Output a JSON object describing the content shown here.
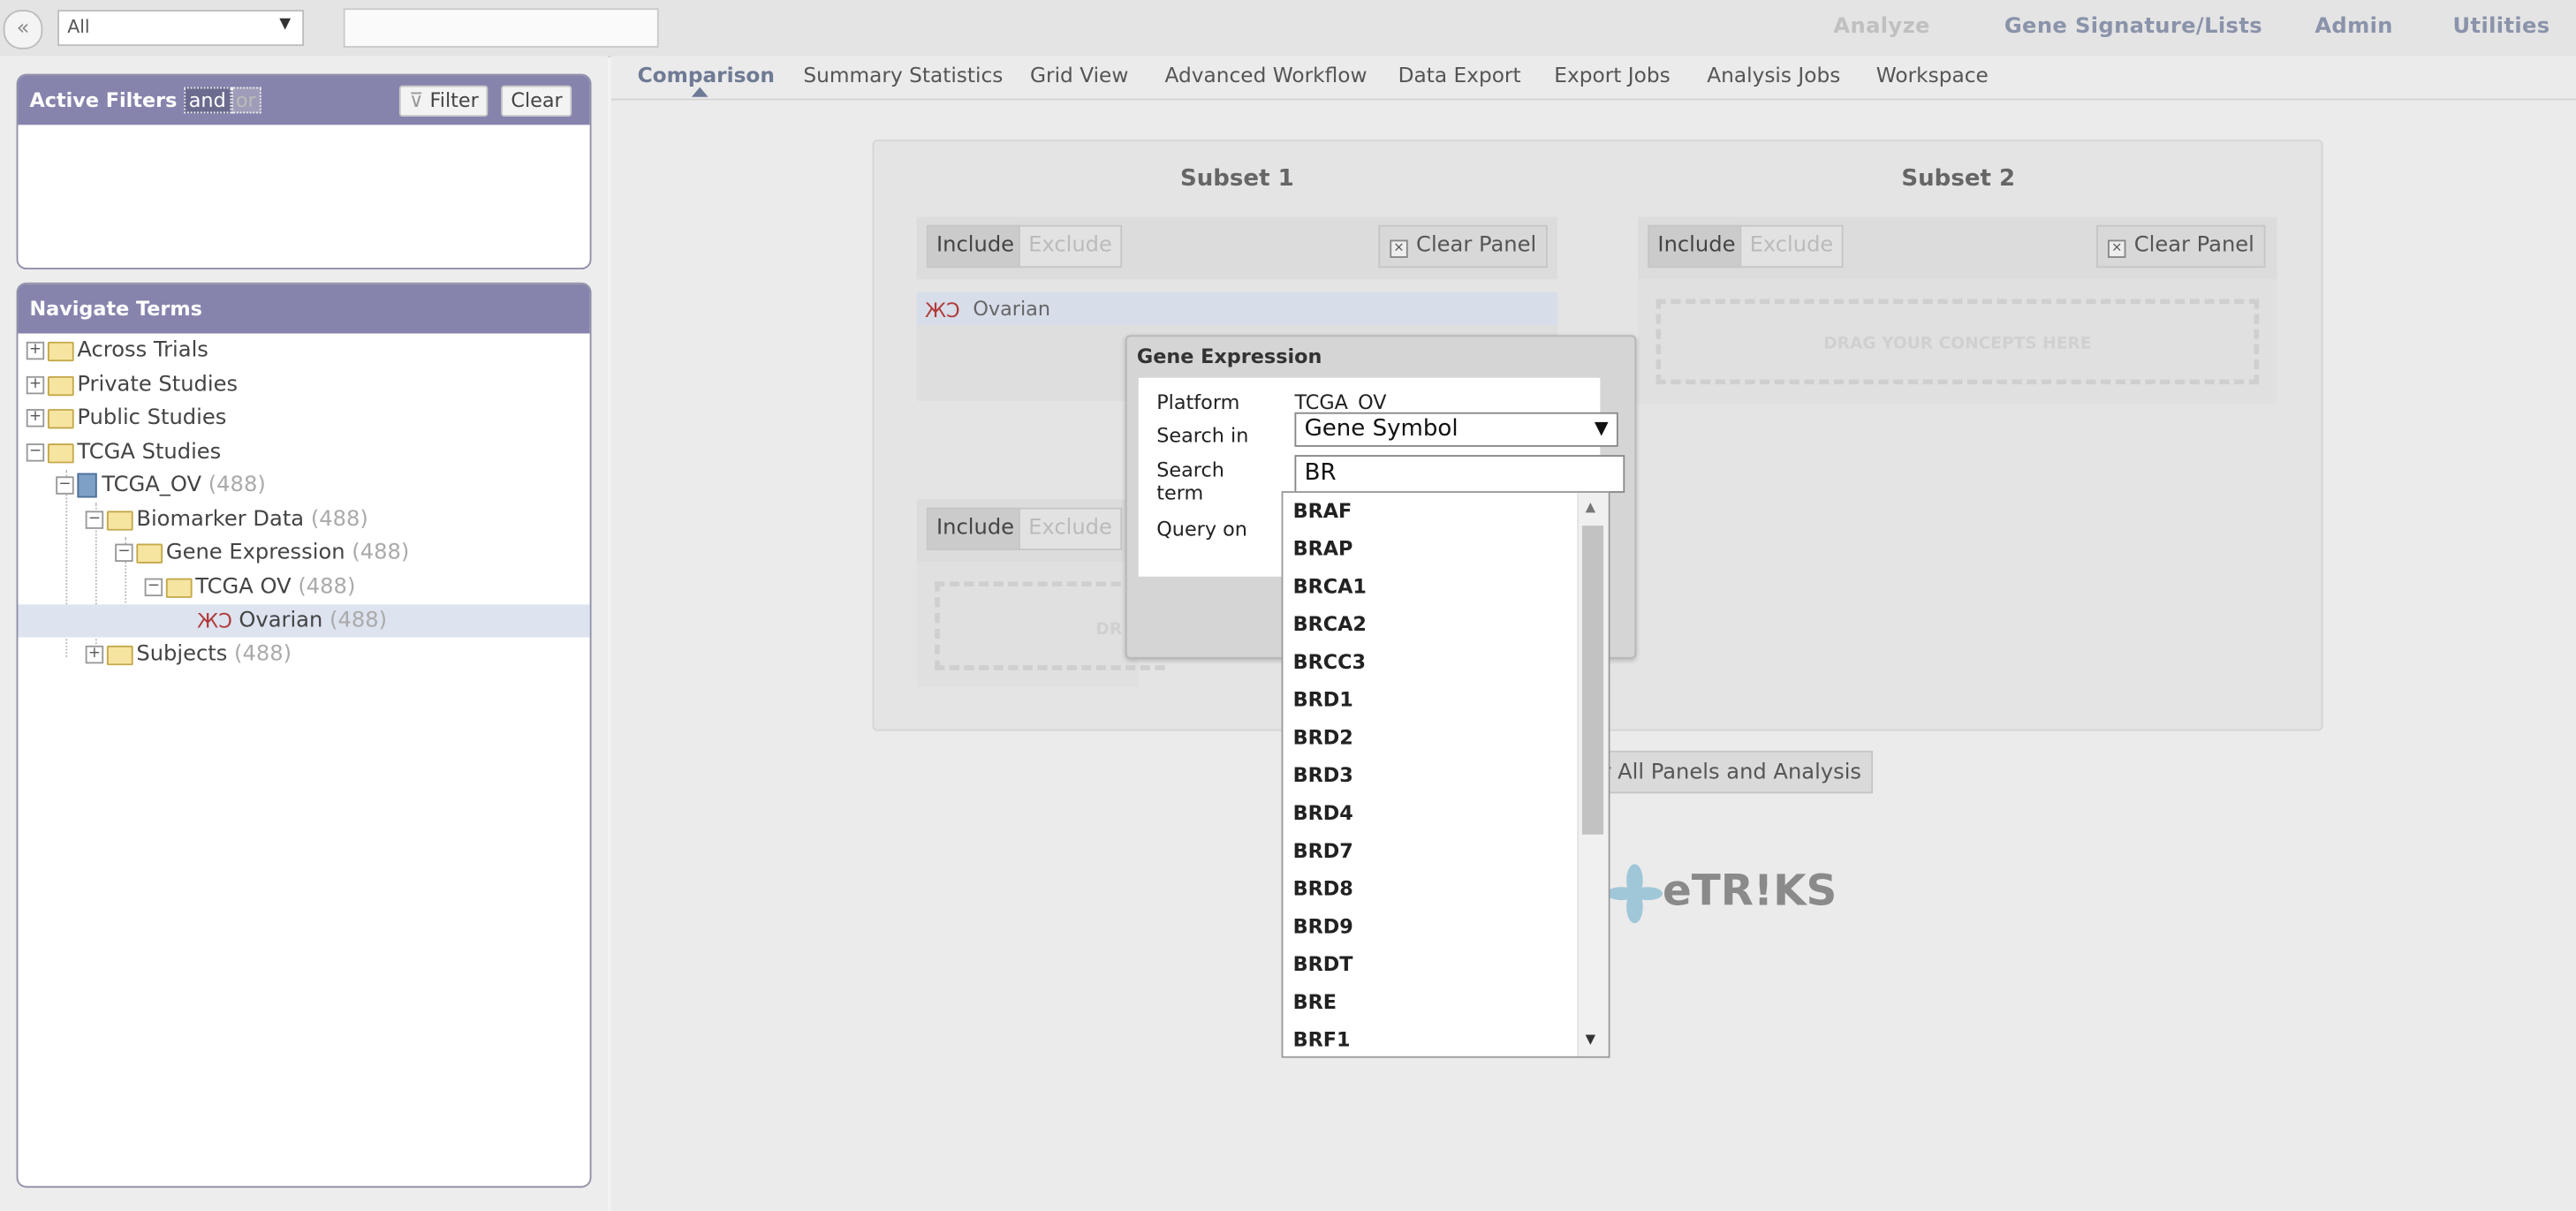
{
  "topbar": {
    "scope_select": "All",
    "search_value": "",
    "nav": [
      "Analyze",
      "Gene Signature/Lists",
      "Admin",
      "Utilities"
    ]
  },
  "filters": {
    "title": "Active Filters",
    "and_label": "and",
    "or_label": "or",
    "filter_label": "Filter",
    "clear_label": "Clear"
  },
  "navigate": {
    "title": "Navigate Terms",
    "tree": [
      {
        "label": "Across Trials",
        "count": ""
      },
      {
        "label": "Private Studies",
        "count": ""
      },
      {
        "label": "Public Studies",
        "count": ""
      },
      {
        "label": "TCGA Studies",
        "count": ""
      },
      {
        "label": "TCGA_OV",
        "count": "(488)"
      },
      {
        "label": "Biomarker Data",
        "count": "(488)"
      },
      {
        "label": "Gene Expression",
        "count": "(488)"
      },
      {
        "label": "TCGA OV",
        "count": "(488)"
      },
      {
        "label": "Ovarian",
        "count": "(488)"
      },
      {
        "label": "Subjects",
        "count": "(488)"
      }
    ]
  },
  "tabs": [
    "Comparison",
    "Summary Statistics",
    "Grid View",
    "Advanced Workflow",
    "Data Export",
    "Export Jobs",
    "Analysis Jobs",
    "Workspace"
  ],
  "subsets": {
    "subset1_title": "Subset 1",
    "subset2_title": "Subset 2",
    "include_label": "Include",
    "exclude_label": "Exclude",
    "clear_panel_label": "Clear Panel",
    "concept_label": "Ovarian",
    "drop_hint": "DRAG YOUR CONCEPTS HERE",
    "drop_hint_partial": "DR",
    "clear_all_label": "r All Panels and Analysis"
  },
  "logo": {
    "text": "eTR!KS"
  },
  "dialog": {
    "title": "Gene Expression",
    "platform_label": "Platform",
    "platform_value": "TCGA_OV",
    "search_in_label": "Search in",
    "search_in_value": "Gene Symbol",
    "search_term_label_1": "Search",
    "search_term_label_2": "term",
    "search_term_value": "BR",
    "query_on_label": "Query on"
  },
  "suggestions": [
    "BRAF",
    "BRAP",
    "BRCA1",
    "BRCA2",
    "BRCC3",
    "BRD1",
    "BRD2",
    "BRD3",
    "BRD4",
    "BRD7",
    "BRD8",
    "BRD9",
    "BRDT",
    "BRE",
    "BRF1"
  ]
}
